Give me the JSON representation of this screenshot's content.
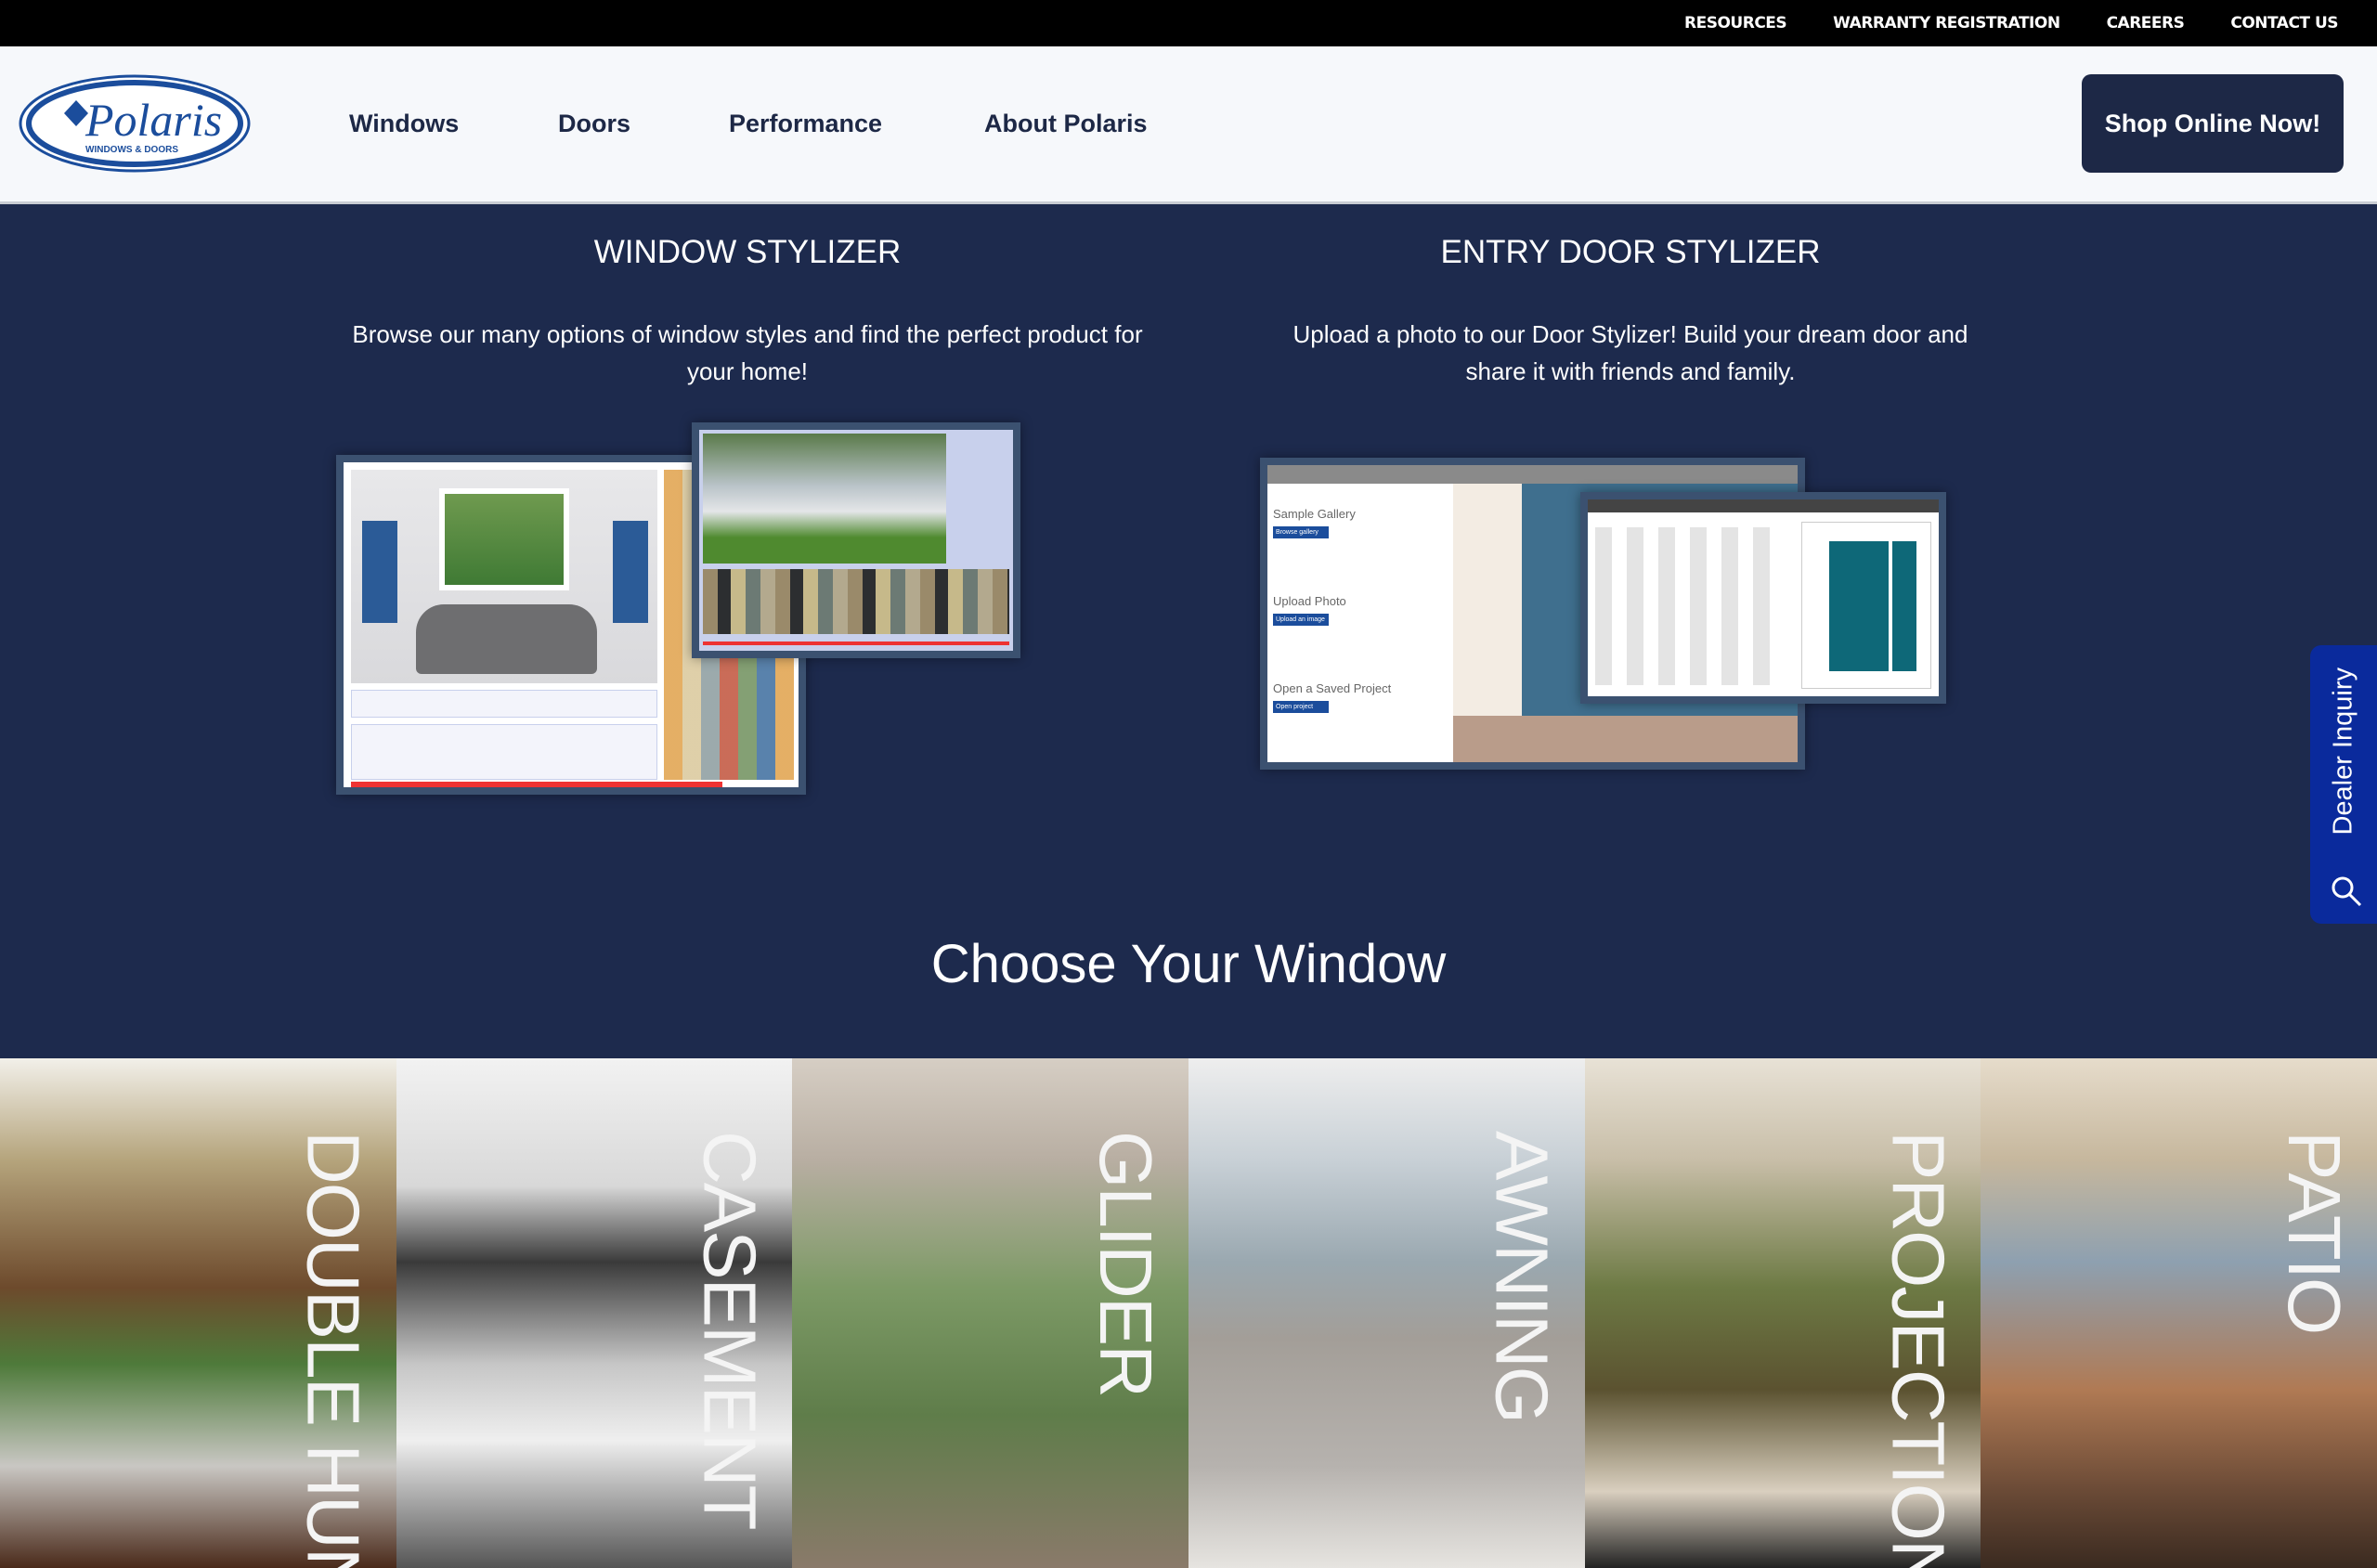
{
  "topbar": {
    "links": [
      "RESOURCES",
      "WARRANTY REGISTRATION",
      "CAREERS",
      "CONTACT US"
    ]
  },
  "header": {
    "logo": {
      "brand": "Polaris",
      "tagline": "WINDOWS & DOORS"
    },
    "nav": [
      "Windows",
      "Doors",
      "Performance",
      "About Polaris"
    ],
    "shop_button": "Shop Online Now!"
  },
  "stylizers": [
    {
      "title": "WINDOW STYLIZER",
      "description": "Browse our many options of window styles and find the perfect product for your home!"
    },
    {
      "title": "ENTRY DOOR STYLIZER",
      "description": "Upload a photo to our Door Stylizer! Build your dream door and share it with friends and family."
    }
  ],
  "door_preview": {
    "sections": [
      "Sample Gallery",
      "Upload Photo",
      "Open a Saved Project"
    ],
    "buttons": [
      "Browse gallery",
      "Upload an image",
      "Open project"
    ]
  },
  "choose": {
    "title": "Choose Your Window"
  },
  "windows": [
    "DOUBLE HUNG",
    "CASEMENT",
    "GLIDER",
    "AWNING",
    "PROJECTION",
    "PATIO"
  ],
  "dealer": {
    "label": "Dealer Inquiry",
    "icon": "search-icon"
  },
  "colors": {
    "navy": "#1d2a4d",
    "button": "#1d2846",
    "dealer": "#0a2a9c"
  }
}
